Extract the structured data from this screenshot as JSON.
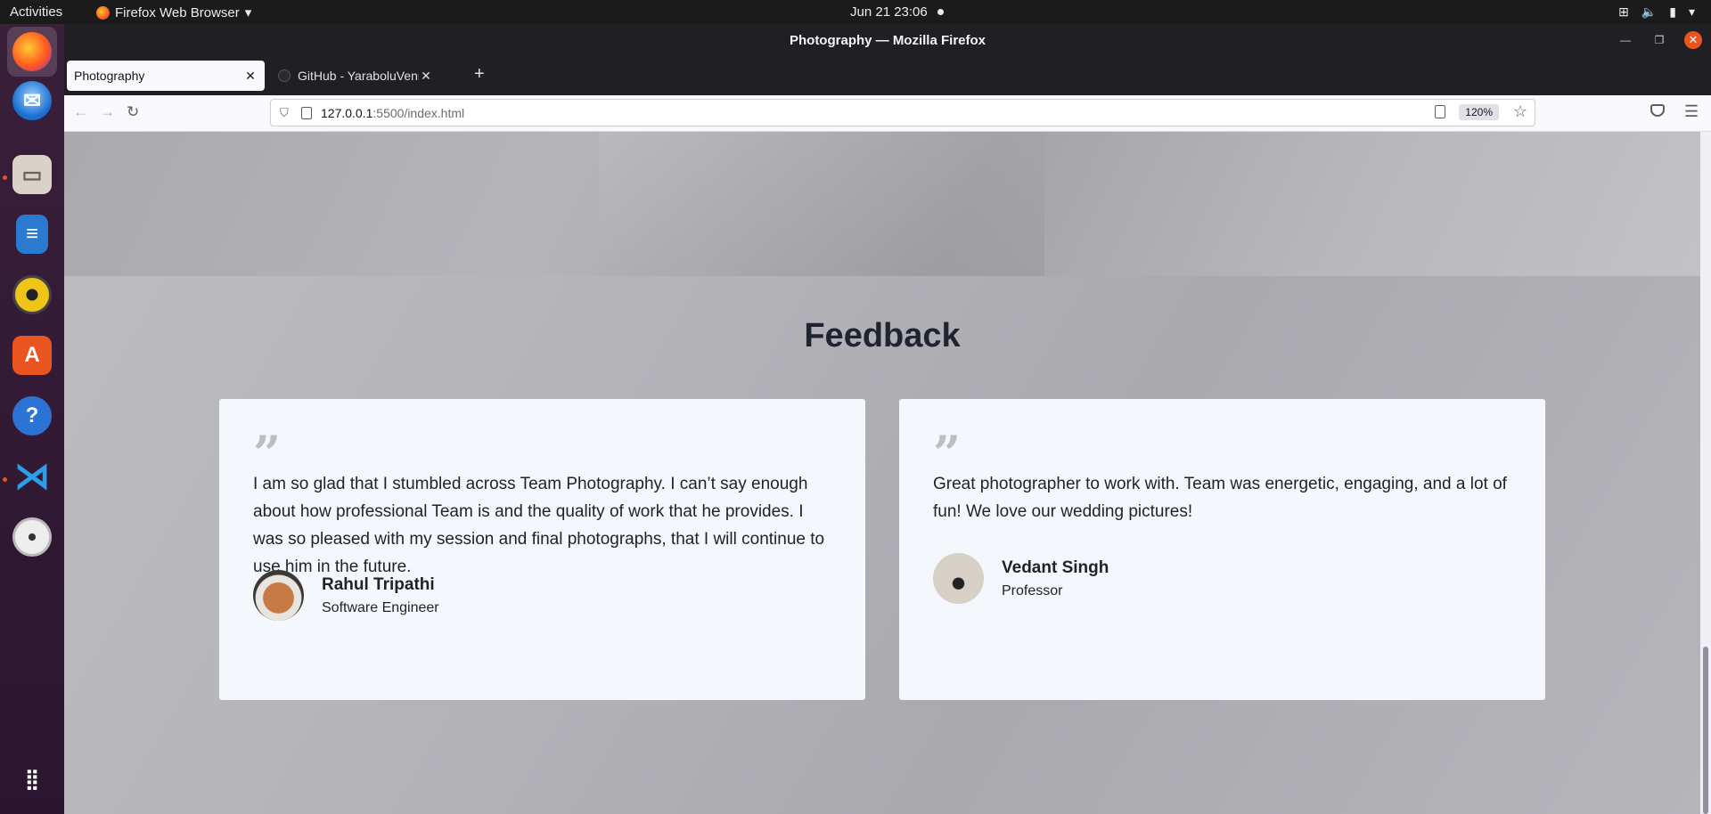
{
  "system": {
    "activities": "Activities",
    "app_menu": "Firefox Web Browser",
    "clock": "Jun 21  23:06"
  },
  "window": {
    "title": "Photography — Mozilla Firefox"
  },
  "tabs": [
    {
      "title": "Photography",
      "active": true
    },
    {
      "title": "GitHub - YaraboluVennela",
      "active": false
    }
  ],
  "urlbar": {
    "host": "127.0.0.1",
    "path": ":5500/index.html",
    "zoom": "120%"
  },
  "feedback": {
    "title": "Feedback",
    "quote_glyph": "”",
    "cards": [
      {
        "text": "I am so glad that I stumbled across Team Photography. I can’t say enough about how professional Team is and the quality of work that he provides. I was so pleased with my session and final photographs, that I will continue to use him in the future.",
        "name": "Rahul Tripathi",
        "role": "Software Engineer"
      },
      {
        "text": "Great photographer to work with. Team was energetic, engaging, and a lot of fun! We love our wedding pictures!",
        "name": "Vedant Singh",
        "role": "Professor"
      }
    ]
  },
  "colors": {
    "ubuntu_orange": "#e95420",
    "heading": "#1f2430",
    "card_bg": "#f4f7fb"
  }
}
